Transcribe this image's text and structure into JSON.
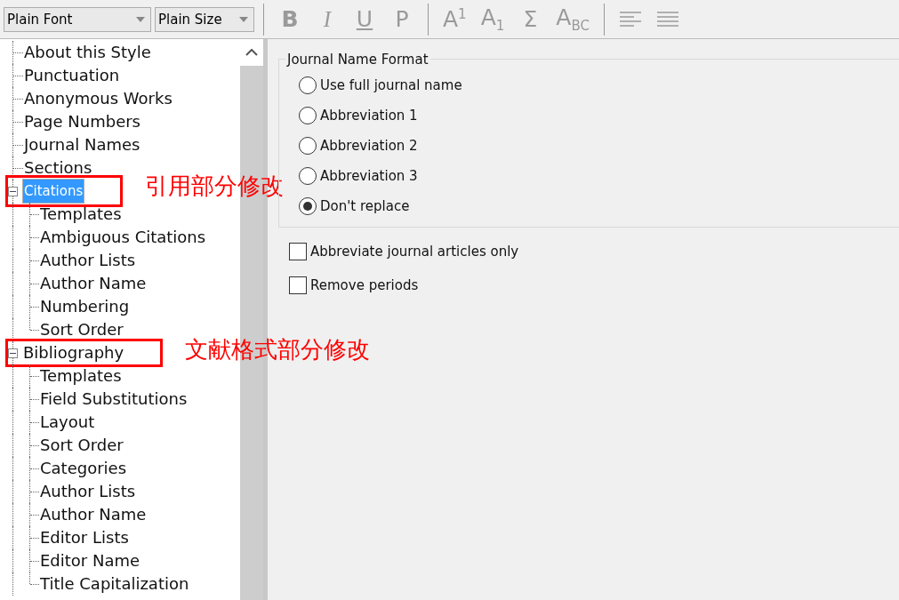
{
  "toolbar": {
    "font_select": {
      "value": "Plain Font"
    },
    "size_select": {
      "value": "Plain Size"
    },
    "button_groups": [
      [
        {
          "kind": "bold",
          "label": "B",
          "disabled": true
        },
        {
          "kind": "italic",
          "label": "I",
          "disabled": true
        },
        {
          "kind": "underline",
          "label": "U",
          "disabled": true
        },
        {
          "kind": "text",
          "label": "P",
          "disabled": true
        }
      ],
      [
        {
          "kind": "text",
          "label": "A$^{1}$",
          "disabled": true
        },
        {
          "kind": "text",
          "label": "A$_{1}$",
          "disabled": true
        },
        {
          "kind": "text",
          "label": "Σ",
          "disabled": true
        },
        {
          "kind": "text",
          "label": "A$_{BC}$",
          "disabled": true
        }
      ],
      [
        {
          "kind": "align-left",
          "disabled": true
        },
        {
          "kind": "align-justify",
          "disabled": true
        }
      ]
    ]
  },
  "tree": [
    {
      "label": "About this Style",
      "selected": false
    },
    {
      "label": "Punctuation",
      "selected": false
    },
    {
      "label": "Anonymous Works",
      "selected": false
    },
    {
      "label": "Page Numbers",
      "selected": false
    },
    {
      "label": "Journal Names",
      "selected": false
    },
    {
      "label": "Sections",
      "selected": false
    },
    {
      "label": "Citations",
      "selected": true,
      "expanded": true,
      "annotation": "引用部分修改",
      "children": [
        {
          "label": "Templates",
          "selected": false
        },
        {
          "label": "Ambiguous Citations",
          "selected": false
        },
        {
          "label": "Author Lists",
          "selected": false
        },
        {
          "label": "Author Name",
          "selected": false
        },
        {
          "label": "Numbering",
          "selected": false
        },
        {
          "label": "Sort Order",
          "selected": false
        }
      ]
    },
    {
      "label": "Bibliography",
      "selected": false,
      "expanded": true,
      "annotation": "文献格式部分修改",
      "children": [
        {
          "label": "Templates",
          "selected": false
        },
        {
          "label": "Field Substitutions",
          "selected": false
        },
        {
          "label": "Layout",
          "selected": false
        },
        {
          "label": "Sort Order",
          "selected": false
        },
        {
          "label": "Categories",
          "selected": false
        },
        {
          "label": "Author Lists",
          "selected": false
        },
        {
          "label": "Author Name",
          "selected": false
        },
        {
          "label": "Editor Lists",
          "selected": false
        },
        {
          "label": "Editor Name",
          "selected": false
        },
        {
          "label": "Title Capitalization",
          "selected": false
        }
      ]
    }
  ],
  "journal_name_format": {
    "title": "Journal Name Format",
    "options": [
      {
        "label": "Use full journal name",
        "selected": false
      },
      {
        "label": "Abbreviation 1",
        "selected": false
      },
      {
        "label": "Abbreviation 2",
        "selected": false
      },
      {
        "label": "Abbreviation 3",
        "selected": false
      },
      {
        "label": "Don't replace",
        "selected": true
      }
    ]
  },
  "checkboxes": [
    {
      "label": "Abbreviate journal articles only",
      "checked": false
    },
    {
      "label": "Remove periods",
      "checked": false
    }
  ]
}
